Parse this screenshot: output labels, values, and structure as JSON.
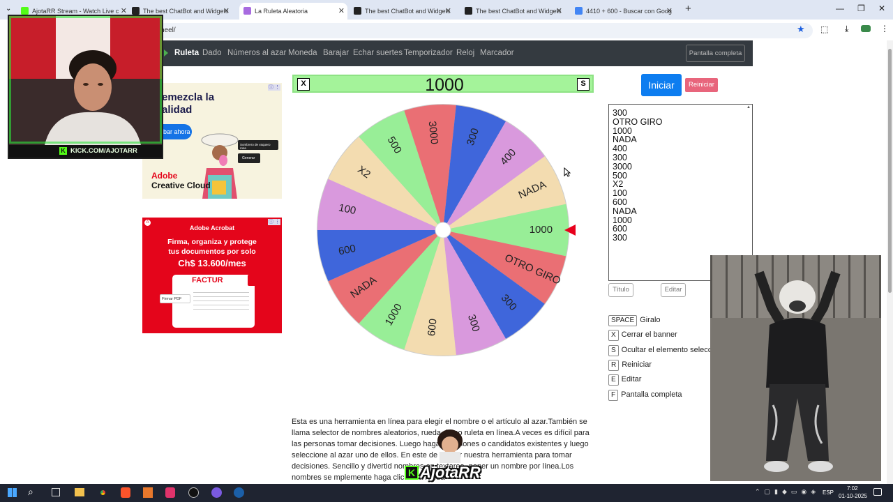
{
  "browser": {
    "tabs": [
      {
        "title": "AjotaRR Stream - Watch Live c",
        "fav": "#53fc18"
      },
      {
        "title": "The best ChatBot and Widgets",
        "fav": "#222"
      },
      {
        "title": "La Ruleta Aleatoria",
        "fav": "#a86be0",
        "active": true
      },
      {
        "title": "The best ChatBot and Widgets",
        "fav": "#222"
      },
      {
        "title": "The best ChatBot and Widgets",
        "fav": "#222"
      },
      {
        "title": "4410 + 600 - Buscar con Goog",
        "fav": "#4285f4"
      }
    ],
    "url": "heel/"
  },
  "nav": {
    "items": [
      "Ruleta",
      "Dado",
      "Números al azar",
      "Moneda",
      "Barajar",
      "Echar suertes",
      "Temporizador",
      "Reloj",
      "Marcador"
    ],
    "fullscreen": "Pantalla completa"
  },
  "ad1": {
    "headline": "emezcla la\nalidad",
    "cta": "bar ahora",
    "brand1": "Adobe",
    "brand2": "Creative Cloud",
    "chip1": "Sombrero de vaquero rosa",
    "chip2": "Generar"
  },
  "ad2": {
    "brand": "Adobe Acrobat",
    "line1": "Firma, organiza y protege",
    "line2": "tus documentos por solo",
    "price": "Ch$ 13.600/mes",
    "doc": "FACTUR",
    "sign": "Firmar PDF"
  },
  "result": {
    "close": "X",
    "value": "1000",
    "s": "S"
  },
  "wheel": {
    "segments": [
      {
        "label": "1000",
        "color": "#98ee97"
      },
      {
        "label": "OTRO GIRO",
        "color": "#ea6f74"
      },
      {
        "label": "300",
        "color": "#3f66db"
      },
      {
        "label": "300",
        "color": "#d999dd"
      },
      {
        "label": "600",
        "color": "#f3dcb0"
      },
      {
        "label": "1000",
        "color": "#98ee97"
      },
      {
        "label": "NADA",
        "color": "#ea6f74"
      },
      {
        "label": "600",
        "color": "#3f66db"
      },
      {
        "label": "100",
        "color": "#d999dd"
      },
      {
        "label": "X2",
        "color": "#f3dcb0"
      },
      {
        "label": "500",
        "color": "#98ee97"
      },
      {
        "label": "3000",
        "color": "#ea6f74"
      },
      {
        "label": "300",
        "color": "#3f66db"
      },
      {
        "label": "400",
        "color": "#d999dd"
      },
      {
        "label": "NADA",
        "color": "#f3dcb0"
      }
    ]
  },
  "panel": {
    "start": "Iniciar",
    "reset": "Reiniciar",
    "names": [
      "300",
      "OTRO GIRO",
      "1000",
      "NADA",
      "400",
      "300",
      "3000",
      "500",
      "X2",
      "100",
      "600",
      "NADA",
      "1000",
      "600",
      "300"
    ],
    "title_btn": "Título",
    "edit_btn": "Editar",
    "shortcuts": [
      {
        "key": "SPACE",
        "label": "Giralo"
      },
      {
        "key": "X",
        "label": "Cerrar el banner"
      },
      {
        "key": "S",
        "label": "Ocultar el elemento seleccio"
      },
      {
        "key": "R",
        "label": "Reiniciar"
      },
      {
        "key": "E",
        "label": "Editar"
      },
      {
        "key": "F",
        "label": "Pantalla completa"
      }
    ]
  },
  "description": "Esta es una herramienta en línea para elegir el nombre o el artículo al azar.También se llama selector de nombres aleatorios, rueda de no        ruleta en línea.A veces es difícil para las personas tomar decisiones. Luego haga una        ciones o candidatos existentes y luego seleccione al azar uno de ellos. En este        de utilizar nuestra herramienta para tomar decisiones. Sencillo y divertid        nombres en textarea, poner un nombre por línea.Los nombres se        mplemente haga clic en la rueda",
  "overlay": {
    "webcam_banner": "KICK.COM/AJOTARR",
    "logo": "AjotaRR"
  },
  "taskbar": {
    "lang": "ESP",
    "time": "7:02",
    "date": "01-10-2025"
  }
}
